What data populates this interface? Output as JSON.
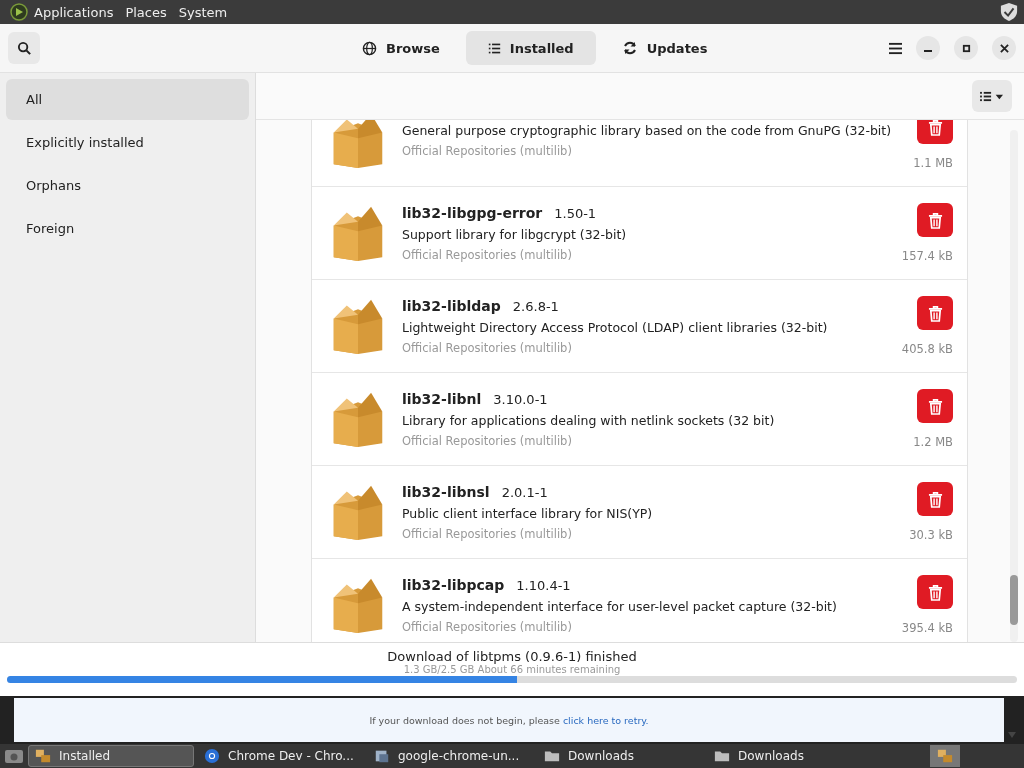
{
  "top_panel": {
    "menus": [
      "Applications",
      "Places",
      "System"
    ]
  },
  "header": {
    "tabs": [
      {
        "label": "Browse",
        "kind": "globe",
        "selected": false
      },
      {
        "label": "Installed",
        "kind": "list",
        "selected": true
      },
      {
        "label": "Updates",
        "kind": "refresh",
        "selected": false
      }
    ]
  },
  "sidebar": {
    "items": [
      {
        "label": "All",
        "selected": true
      },
      {
        "label": "Explicitly installed",
        "selected": false
      },
      {
        "label": "Orphans",
        "selected": false
      },
      {
        "label": "Foreign",
        "selected": false
      }
    ]
  },
  "packages": [
    {
      "description": "General purpose cryptographic library based on the code from GnuPG (32-bit)",
      "repository": "Official Repositories (multilib)",
      "size": "1.1 MB"
    },
    {
      "name": "lib32-libgpg-error",
      "version": "1.50-1",
      "description": "Support library for libgcrypt (32-bit)",
      "repository": "Official Repositories (multilib)",
      "size": "157.4 kB"
    },
    {
      "name": "lib32-libldap",
      "version": "2.6.8-1",
      "description": "Lightweight Directory Access Protocol (LDAP) client libraries (32-bit)",
      "repository": "Official Repositories (multilib)",
      "size": "405.8 kB"
    },
    {
      "name": "lib32-libnl",
      "version": "3.10.0-1",
      "description": "Library for applications dealing with netlink sockets (32 bit)",
      "repository": "Official Repositories (multilib)",
      "size": "1.2 MB"
    },
    {
      "name": "lib32-libnsl",
      "version": "2.0.1-1",
      "description": "Public client interface library for NIS(YP)",
      "repository": "Official Repositories (multilib)",
      "size": "30.3 kB"
    },
    {
      "name": "lib32-libpcap",
      "version": "1.10.4-1",
      "description": "A system-independent interface for user-level packet capture (32-bit)",
      "repository": "Official Repositories (multilib)",
      "size": "395.4 kB"
    }
  ],
  "download": {
    "title": "Download of libtpms (0.9.6-1) finished",
    "detail": "1.3 GB/2.5 GB About 66 minutes remaining",
    "level": 0.505
  },
  "browser_notice": {
    "text": "If your download does not begin, please",
    "link": "click here to retry."
  },
  "taskbar": [
    {
      "label": "Installed",
      "kind": "app",
      "selected": true
    },
    {
      "label": "Chrome Dev - Chro...",
      "kind": "browser",
      "selected": false
    },
    {
      "label": "google-chrome-un...",
      "kind": "installer",
      "selected": false
    },
    {
      "label": "Downloads",
      "kind": "folder",
      "selected": false
    },
    {
      "label": "Downloads",
      "kind": "folder",
      "selected": false
    }
  ]
}
